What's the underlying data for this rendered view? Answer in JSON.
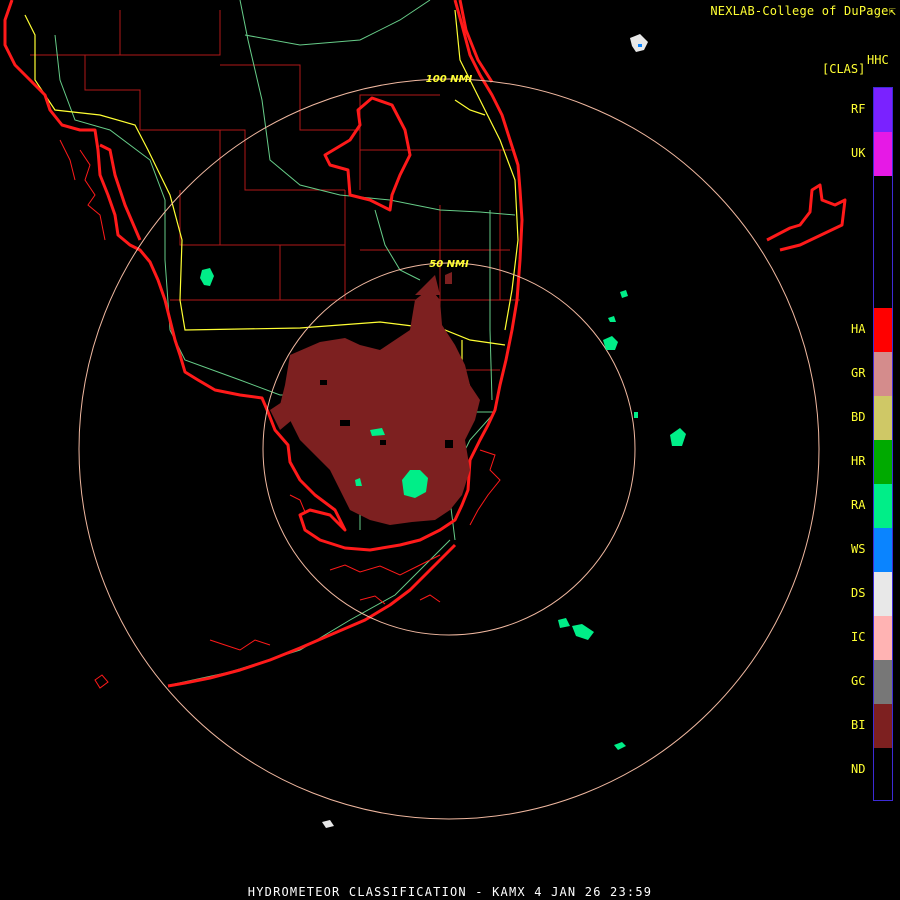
{
  "credit": "NEXLAB-College of DuPage",
  "credit_glyph": "⇱",
  "product_code": "HHC",
  "product_class": "[CLAS]",
  "ring_labels": {
    "inner": "50 NMI",
    "outer": "100 NMI"
  },
  "legend": [
    {
      "code": "RF",
      "color": "#7a22ff"
    },
    {
      "code": "UK",
      "color": "#e619e6"
    },
    {
      "code": "",
      "color": "#000000"
    },
    {
      "code": "HA",
      "color": "#ff0000"
    },
    {
      "code": "GR",
      "color": "#d48c8c"
    },
    {
      "code": "BD",
      "color": "#cfc866"
    },
    {
      "code": "HR",
      "color": "#00aa00"
    },
    {
      "code": "RA",
      "color": "#00ee88"
    },
    {
      "code": "WS",
      "color": "#0a84ff"
    },
    {
      "code": "DS",
      "color": "#e8e8e8"
    },
    {
      "code": "IC",
      "color": "#ffb3b3"
    },
    {
      "code": "GC",
      "color": "#777777"
    },
    {
      "code": "BI",
      "color": "#7d2020"
    },
    {
      "code": "ND",
      "color": "#000000"
    }
  ],
  "footer": "HYDROMETEOR CLASSIFICATION - KAMX 4 JAN 26 23:59",
  "colors": {
    "coastline": "#ff1a1a",
    "county": "#b01818",
    "highway": "#66cc88",
    "interstate": "#ffff33",
    "range_ring": "#f0b8a0",
    "bio_echo": "#7d2020",
    "rain_echo": "#00ee88"
  }
}
